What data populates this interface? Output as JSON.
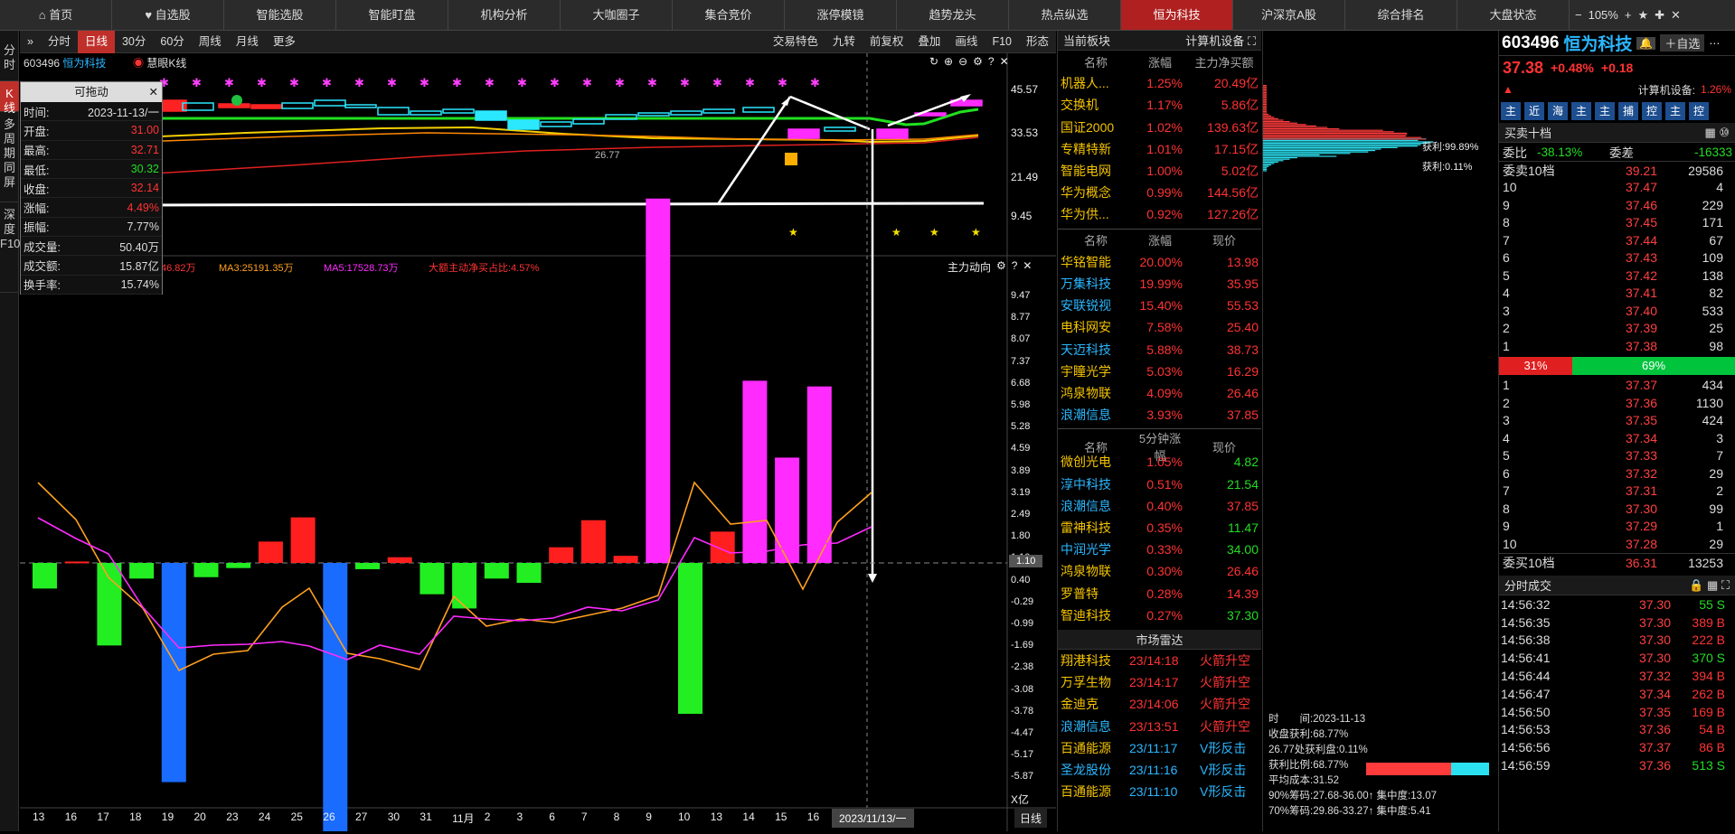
{
  "topnav": {
    "tabs": [
      "首页",
      "自选股",
      "智能选股",
      "智能盯盘",
      "机构分析",
      "大咖圈子",
      "集合竞价",
      "涨停模镜",
      "趋势龙头",
      "热点纵选",
      "恒为科技",
      "沪深京A股",
      "综合排名",
      "大盘状态"
    ],
    "active_index": 10,
    "zoom": "105%"
  },
  "leftrail": [
    "分时",
    "K线",
    "多周期同屏",
    "深度F10"
  ],
  "toolbar": {
    "items": [
      "分时",
      "日线",
      "30分",
      "60分",
      "周线",
      "月线",
      "更多"
    ],
    "active_index": 1,
    "right_items": [
      "交易特色",
      "九转",
      "前复权",
      "叠加",
      "画线",
      "F10",
      "形态"
    ]
  },
  "chart": {
    "stock_code": "603496",
    "stock_name": "恒为科技",
    "indicator": "慧眼K线",
    "price_axis": [
      "45.57",
      "33.53",
      "21.49",
      "9.45"
    ],
    "price_low_label": "26.77",
    "low_panel_title": "主力动向",
    "low_legend": [
      "46.82万",
      "MA3:25191.35万",
      "MA5:17528.73万",
      "大额主动净买占比:4.57%"
    ],
    "low_axis": [
      "9.47",
      "8.77",
      "8.07",
      "7.37",
      "6.68",
      "5.98",
      "5.28",
      "4.59",
      "3.89",
      "3.19",
      "2.49",
      "1.80",
      "1.10",
      "0.40",
      "-0.29",
      "-0.99",
      "-1.69",
      "-2.38",
      "-3.08",
      "-3.78",
      "-4.47",
      "-5.17",
      "-5.87"
    ],
    "unit": "X亿",
    "current_value": "1.10",
    "dates": [
      "13",
      "16",
      "17",
      "18",
      "19",
      "20",
      "23",
      "24",
      "25",
      "26",
      "27",
      "30",
      "31",
      "11月",
      "2",
      "3",
      "6",
      "7",
      "8",
      "9",
      "10",
      "13",
      "14",
      "15",
      "16"
    ],
    "cursor_date": "2023/11/13/一",
    "period": "日线"
  },
  "chart_data": {
    "type": "bar",
    "series": [
      {
        "name": "主力动向",
        "values": [
          -0.9,
          0.05,
          -2.9,
          -0.55,
          -7.7,
          -0.5,
          -0.18,
          0.75,
          1.6,
          -10.6,
          -0.22,
          0.2,
          -1.1,
          -1.6,
          -0.55,
          -0.7,
          0.55,
          1.5,
          0.25,
          12.8,
          -5.3,
          1.1,
          6.4,
          3.7,
          6.2
        ]
      }
    ],
    "categories": [
      "13",
      "16",
      "17",
      "18",
      "19",
      "20",
      "23",
      "24",
      "25",
      "26",
      "27",
      "30",
      "31",
      "11月",
      "2",
      "3",
      "6",
      "7",
      "8",
      "9",
      "10",
      "13",
      "14",
      "15",
      "16"
    ]
  },
  "infobox": {
    "title": "可拖动",
    "rows": [
      [
        "时间:",
        "2023-11-13/一"
      ],
      [
        "开盘:",
        "31.00"
      ],
      [
        "最高:",
        "32.71"
      ],
      [
        "最低:",
        "30.32"
      ],
      [
        "收盘:",
        "32.14"
      ],
      [
        "涨幅:",
        "4.49%"
      ],
      [
        "振幅:",
        "7.77%"
      ],
      [
        "成交量:",
        "50.40万"
      ],
      [
        "成交额:",
        "15.87亿"
      ],
      [
        "换手率:",
        "15.74%"
      ]
    ]
  },
  "sector": {
    "title": "当前板块",
    "subtitle": "计算机设备",
    "headers": [
      "名称",
      "涨幅",
      "主力净买额"
    ],
    "rows": [
      [
        "机器人...",
        "1.25%",
        "20.49亿"
      ],
      [
        "交换机",
        "1.17%",
        "5.86亿"
      ],
      [
        "国证2000",
        "1.02%",
        "139.63亿"
      ],
      [
        "专精特新",
        "1.01%",
        "17.15亿"
      ],
      [
        "智能电网",
        "1.00%",
        "5.02亿"
      ],
      [
        "华为概念",
        "0.99%",
        "144.56亿"
      ],
      [
        "华为供...",
        "0.92%",
        "127.26亿"
      ]
    ]
  },
  "gainers": {
    "headers": [
      "名称",
      "涨幅",
      "现价"
    ],
    "rows": [
      [
        "华铭智能",
        "20.00%",
        "13.98"
      ],
      [
        "万集科技",
        "19.99%",
        "35.95"
      ],
      [
        "安联锐视",
        "15.40%",
        "55.53"
      ],
      [
        "电科网安",
        "7.58%",
        "25.40"
      ],
      [
        "天迈科技",
        "5.88%",
        "38.73"
      ],
      [
        "宇瞳光学",
        "5.03%",
        "16.29"
      ],
      [
        "鸿泉物联",
        "4.09%",
        "26.46"
      ],
      [
        "浪潮信息",
        "3.93%",
        "37.85"
      ]
    ]
  },
  "fivemin": {
    "headers": [
      "名称",
      "5分钟涨幅",
      "现价"
    ],
    "rows": [
      [
        "微创光电",
        "1.05%",
        "4.82"
      ],
      [
        "淳中科技",
        "0.51%",
        "21.54"
      ],
      [
        "浪潮信息",
        "0.40%",
        "37.85"
      ],
      [
        "雷神科技",
        "0.35%",
        "11.47"
      ],
      [
        "中润光学",
        "0.33%",
        "34.00"
      ],
      [
        "鸿泉物联",
        "0.30%",
        "26.46"
      ],
      [
        "罗普特",
        "0.28%",
        "14.39"
      ],
      [
        "智迪科技",
        "0.27%",
        "37.30"
      ]
    ]
  },
  "radar": {
    "title": "市场雷达",
    "rows": [
      [
        "翔港科技",
        "23/14:18",
        "火箭升空"
      ],
      [
        "万孚生物",
        "23/14:17",
        "火箭升空"
      ],
      [
        "金迪克",
        "23/14:06",
        "火箭升空"
      ],
      [
        "浪潮信息",
        "23/13:51",
        "火箭升空"
      ],
      [
        "百通能源",
        "23/11:17",
        "V形反击"
      ],
      [
        "圣龙股份",
        "23/11:16",
        "V形反击"
      ],
      [
        "百通能源",
        "23/11:10",
        "V形反击"
      ]
    ]
  },
  "chip": {
    "profit_top": "获利:99.89%",
    "profit_bottom": "获利:0.11%",
    "lines": [
      "时　　间:2023-11-13",
      "收盘获利:68.77%",
      "26.77处获利盘:0.11%",
      "获利比例:68.77%",
      "平均成本:31.52",
      "90%筹码:27.68-36.00↑ 集中度:13.07",
      "70%筹码:29.86-33.27↑ 集中度:5.41"
    ]
  },
  "quote": {
    "code": "603496",
    "name": "恒为科技",
    "price": "37.38",
    "change_pct": "+0.48%",
    "change": "+0.18",
    "sector_label": "计算机设备:",
    "sector_pct": "1.26%",
    "mode_buttons": [
      "主",
      "近",
      "海",
      "主",
      "主",
      "捕",
      "控",
      "主",
      "控"
    ],
    "orderbook_title": "买卖十档",
    "weibi_label": "委比",
    "weibi": "-38.13%",
    "weicha_label": "委差",
    "weicha": "-16333",
    "sell_total_label": "委卖10档",
    "sell_total_price": "39.21",
    "sell_total_vol": "29586",
    "sells": [
      [
        "10",
        "37.47",
        "4"
      ],
      [
        "9",
        "37.46",
        "229"
      ],
      [
        "8",
        "37.45",
        "171"
      ],
      [
        "7",
        "37.44",
        "67"
      ],
      [
        "6",
        "37.43",
        "109"
      ],
      [
        "5",
        "37.42",
        "138"
      ],
      [
        "4",
        "37.41",
        "82"
      ],
      [
        "3",
        "37.40",
        "533"
      ],
      [
        "2",
        "37.39",
        "25"
      ],
      [
        "1",
        "37.38",
        "98"
      ]
    ],
    "buy_ratio": "31%",
    "sell_ratio": "69%",
    "buys": [
      [
        "1",
        "37.37",
        "434"
      ],
      [
        "2",
        "37.36",
        "1130"
      ],
      [
        "3",
        "37.35",
        "424"
      ],
      [
        "4",
        "37.34",
        "3"
      ],
      [
        "5",
        "37.33",
        "7"
      ],
      [
        "6",
        "37.32",
        "29"
      ],
      [
        "7",
        "37.31",
        "2"
      ],
      [
        "8",
        "37.30",
        "99"
      ],
      [
        "9",
        "37.29",
        "1"
      ],
      [
        "10",
        "37.28",
        "29"
      ]
    ],
    "buy_total_label": "委买10档",
    "buy_total_price": "36.31",
    "buy_total_vol": "13253",
    "ticks_title": "分时成交",
    "ticks": [
      [
        "14:56:32",
        "37.30",
        "55 S"
      ],
      [
        "14:56:35",
        "37.30",
        "389 B"
      ],
      [
        "14:56:38",
        "37.30",
        "222 B"
      ],
      [
        "14:56:41",
        "37.30",
        "370 S"
      ],
      [
        "14:56:44",
        "37.32",
        "394 B"
      ],
      [
        "14:56:47",
        "37.34",
        "262 B"
      ],
      [
        "14:56:50",
        "37.35",
        "169 B"
      ],
      [
        "14:56:53",
        "37.36",
        "54 B"
      ],
      [
        "14:56:56",
        "37.37",
        "86 B"
      ],
      [
        "14:56:59",
        "37.36",
        "513 S"
      ]
    ]
  },
  "colors": {
    "up": "#ff3333",
    "down": "#22dd22",
    "accent": "#c0302b",
    "magenta": "#ff2bff",
    "blue": "#1a6cff"
  }
}
